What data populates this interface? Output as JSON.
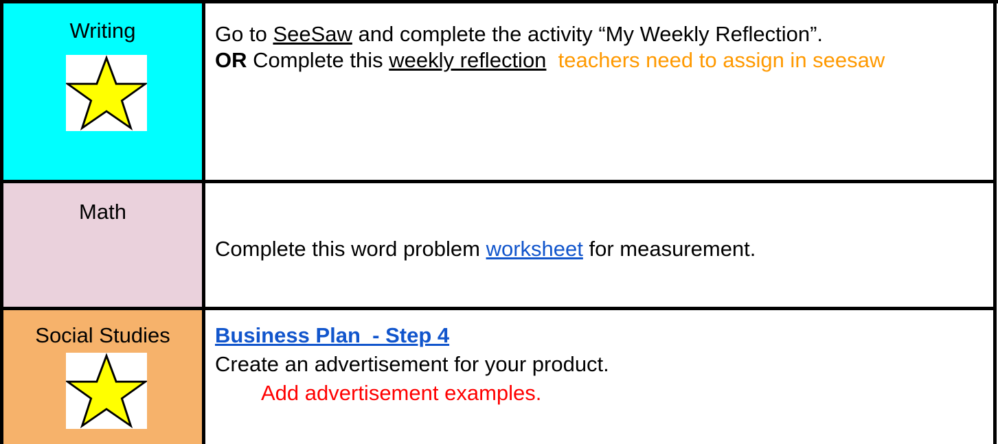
{
  "rows": [
    {
      "subject": "Writing",
      "subject_bg": "#00ffff",
      "has_star": true,
      "text": {
        "p1_before": "Go to ",
        "p1_link": "SeeSaw",
        "p1_after": " and complete the activity “My Weekly Reflection”.",
        "p2_bold": "OR",
        "p2_before": " Complete this ",
        "p2_link": "weekly reflection",
        "p2_note": "teachers need to assign in seesaw"
      }
    },
    {
      "subject": "Math",
      "subject_bg": "#ead1dc",
      "has_star": false,
      "text": {
        "before": "Complete this word problem ",
        "link": "worksheet",
        "after": " for measurement."
      }
    },
    {
      "subject": "Social Studies",
      "subject_bg": "#f6b26b",
      "has_star": true,
      "text": {
        "heading_link": "Business Plan  - Step 4",
        "line2": "Create an advertisement for your product.",
        "note": "Add advertisement examples."
      }
    }
  ],
  "colors": {
    "star_fill": "#ffff00",
    "link_blue": "#1155cc",
    "note_orange": "#ff9900",
    "note_red": "#ff0000"
  },
  "icons": [
    "star-icon"
  ]
}
